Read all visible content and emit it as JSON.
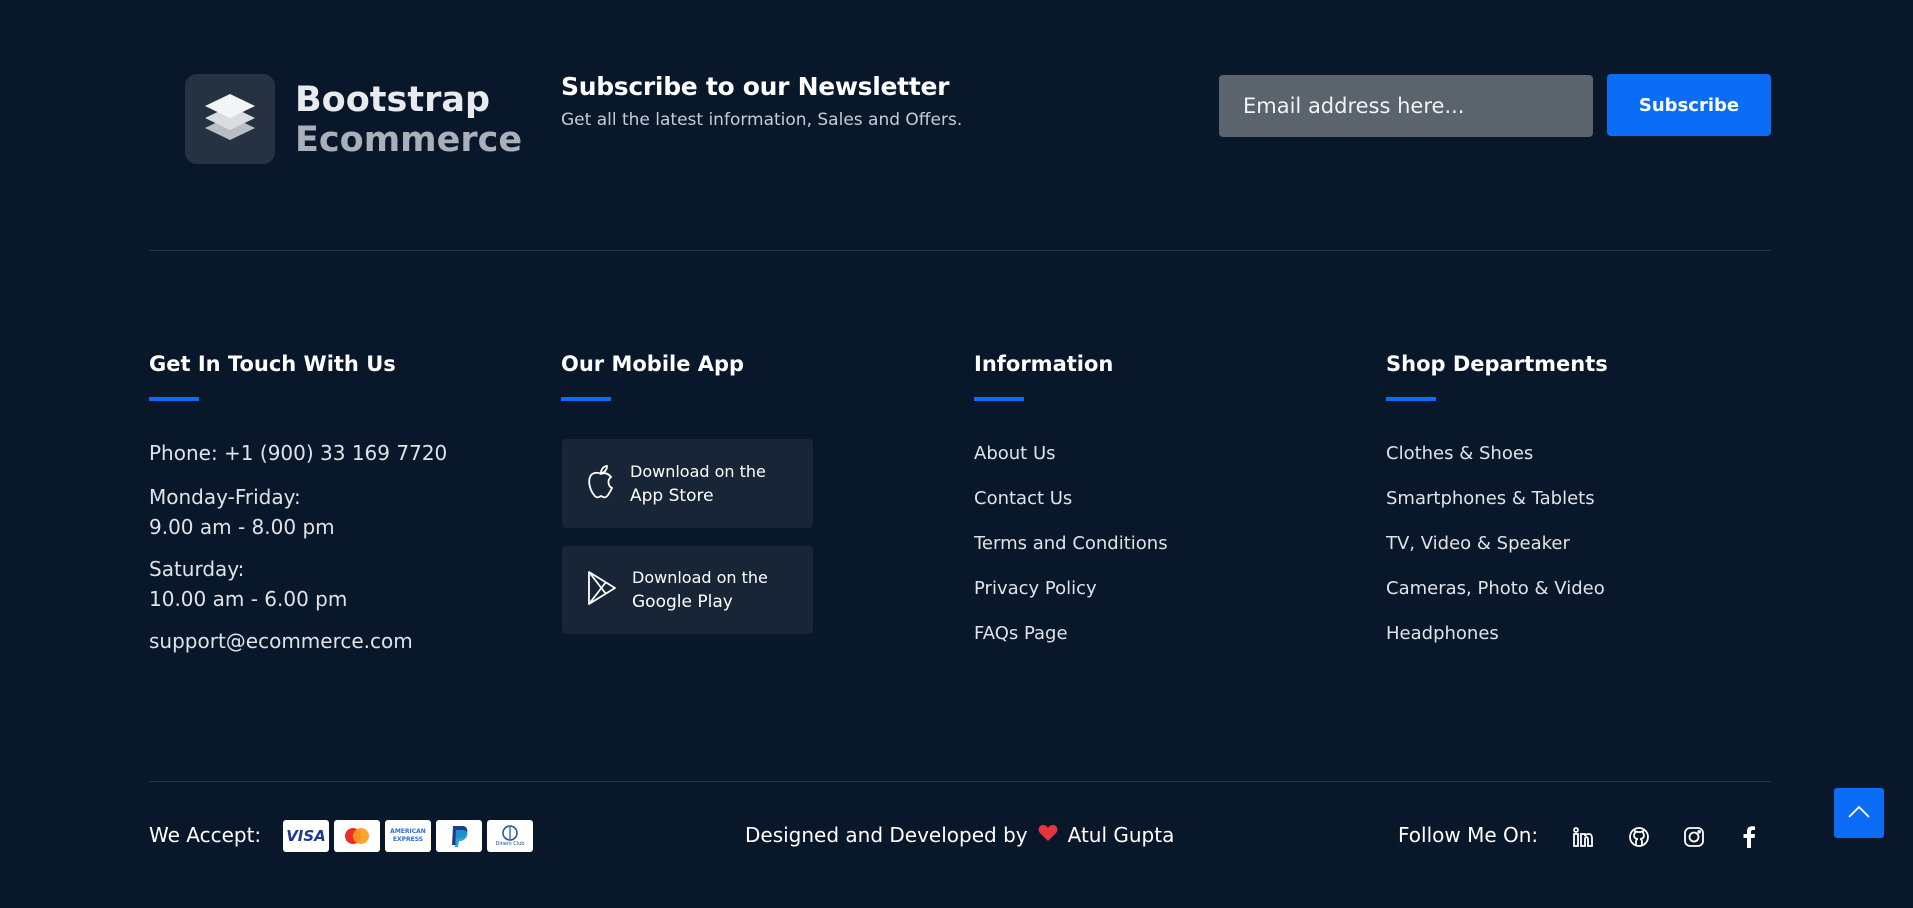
{
  "brand": {
    "line1": "Bootstrap",
    "line2": "Ecommerce"
  },
  "newsletter": {
    "title": "Subscribe to our Newsletter",
    "subtitle": "Get all the latest information, Sales and Offers.",
    "email_placeholder": "Email address here...",
    "subscribe_label": "Subscribe"
  },
  "columns": {
    "contact": {
      "title": "Get In Touch With Us",
      "phone": "Phone: +1 (900) 33 169 7720",
      "weekday_label": "Monday-Friday:",
      "weekday_hours": "9.00 am - 8.00 pm",
      "saturday_label": "Saturday:",
      "saturday_hours": "10.00 am - 6.00 pm",
      "email": "support@ecommerce.com"
    },
    "app": {
      "title": "Our Mobile App",
      "appstore_line1": "Download on the",
      "appstore_line2": "App Store",
      "googleplay_line1": "Download on the",
      "googleplay_line2": "Google Play"
    },
    "information": {
      "title": "Information",
      "links": [
        "About Us",
        "Contact Us",
        "Terms and Conditions",
        "Privacy Policy",
        "FAQs Page"
      ]
    },
    "departments": {
      "title": "Shop Departments",
      "links": [
        "Clothes & Shoes",
        "Smartphones & Tablets",
        "TV, Video & Speaker",
        "Cameras, Photo & Video",
        "Headphones"
      ]
    }
  },
  "bottom": {
    "accept_label": "We Accept:",
    "payment_icons": [
      "visa-icon",
      "mastercard-icon",
      "american-express-icon",
      "paypal-icon",
      "diners-club-icon"
    ],
    "visa_text": "VISA",
    "amex_text": "AMERICAN EXPRESS",
    "diners_text": "Diners Club",
    "credit_prefix": "Designed and Developed by",
    "credit_name": "Atul Gupta",
    "follow_label": "Follow Me On:",
    "social_icons": [
      "linkedin-icon",
      "github-icon",
      "instagram-icon",
      "facebook-icon"
    ]
  },
  "colors": {
    "background": "#09172a",
    "accent": "#0b6cf5",
    "heart": "#e8323c"
  }
}
